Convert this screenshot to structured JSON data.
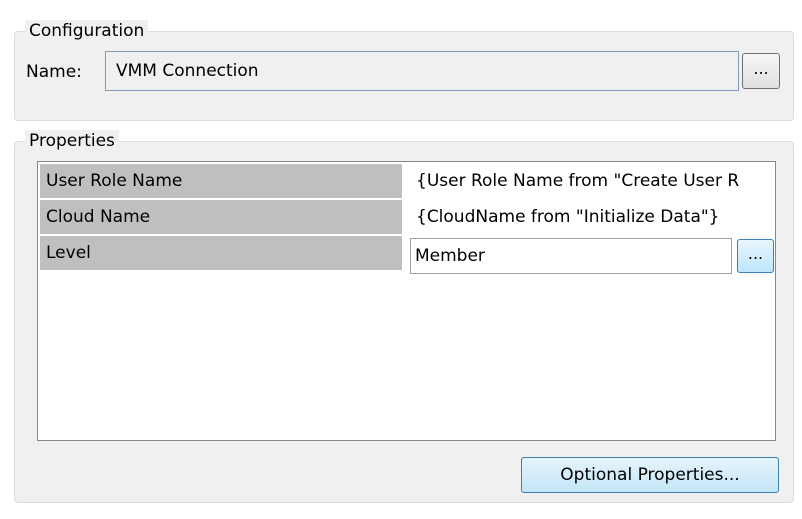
{
  "configuration": {
    "legend": "Configuration",
    "name_label": "Name:",
    "name_value": "VMM Connection",
    "browse_label": "..."
  },
  "properties": {
    "legend": "Properties",
    "rows": [
      {
        "name": "User Role Name",
        "value": "{User Role Name from \"Create User R"
      },
      {
        "name": "Cloud Name",
        "value": "{CloudName from \"Initialize Data\"}"
      },
      {
        "name": "Level",
        "value": "Member",
        "browse_label": "..."
      }
    ],
    "optional_button": "Optional Properties..."
  }
}
